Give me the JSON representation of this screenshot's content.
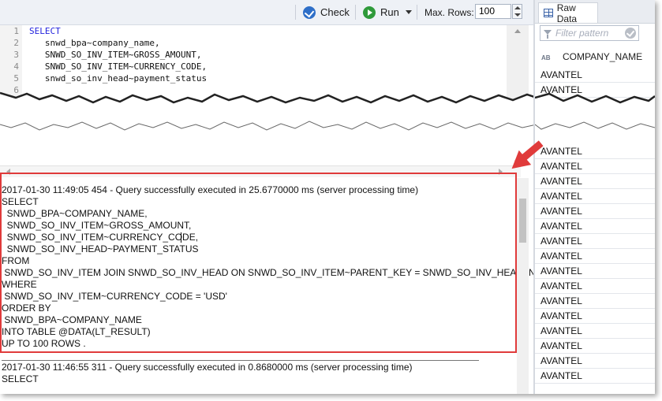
{
  "toolbar": {
    "check_label": "Check",
    "run_label": "Run",
    "max_rows_label": "Max. Rows:",
    "max_rows_value": "100"
  },
  "editor": {
    "lines": [
      {
        "num": "1",
        "text": "SELECT"
      },
      {
        "num": "2",
        "text": "   snwd_bpa~company_name,"
      },
      {
        "num": "3",
        "text": "   SNWD_SO_INV_ITEM~GROSS_AMOUNT,"
      },
      {
        "num": "4",
        "text": "   SNWD_SO_INV_ITEM~CURRENCY_CODE,"
      },
      {
        "num": "5",
        "text": "   snwd_so_inv_head~payment_status"
      },
      {
        "num": "6",
        "text": ""
      }
    ]
  },
  "console": {
    "entries": [
      "2017-01-30 11:49:05 454 - Query successfully executed in 25.6770000 ms (server processing time)",
      "SELECT",
      "  SNWD_BPA~COMPANY_NAME,",
      "  SNWD_SO_INV_ITEM~GROSS_AMOUNT,",
      "  SNWD_SO_INV_ITEM~CURRENCY_CODE,",
      "  SNWD_SO_INV_HEAD~PAYMENT_STATUS",
      "FROM",
      " SNWD_SO_INV_ITEM JOIN SNWD_SO_INV_HEAD ON SNWD_SO_INV_ITEM~PARENT_KEY = SNWD_SO_INV_HEAD~NODE_K",
      "WHERE",
      " SNWD_SO_INV_ITEM~CURRENCY_CODE = 'USD'",
      "ORDER BY",
      " SNWD_BPA~COMPANY_NAME",
      "INTO TABLE @DATA(LT_RESULT)",
      "UP TO 100 ROWS ."
    ],
    "second_entry": "2017-01-30 11:46:55 311 - Query successfully executed in 0.8680000 ms (server processing time)",
    "second_select": "SELECT"
  },
  "raw_data": {
    "tab_label": "Raw Data",
    "filter_placeholder": "Filter pattern",
    "type_badge": "AB",
    "column_header": "COMPANY_NAME",
    "rows_top": [
      "AVANTEL",
      "AVANTEL"
    ],
    "rows_bottom": [
      "AVANTEL",
      "AVANTEL",
      "AVANTEL",
      "AVANTEL",
      "AVANTEL",
      "AVANTEL",
      "AVANTEL",
      "AVANTEL",
      "AVANTEL",
      "AVANTEL",
      "AVANTEL",
      "AVANTEL",
      "AVANTEL",
      "AVANTEL",
      "AVANTEL",
      "AVANTEL"
    ]
  },
  "colors": {
    "highlight": "#e03b3b",
    "keyword": "#2222dd",
    "check_icon": "#2e6fc8",
    "run_icon": "#2f9a3a"
  }
}
